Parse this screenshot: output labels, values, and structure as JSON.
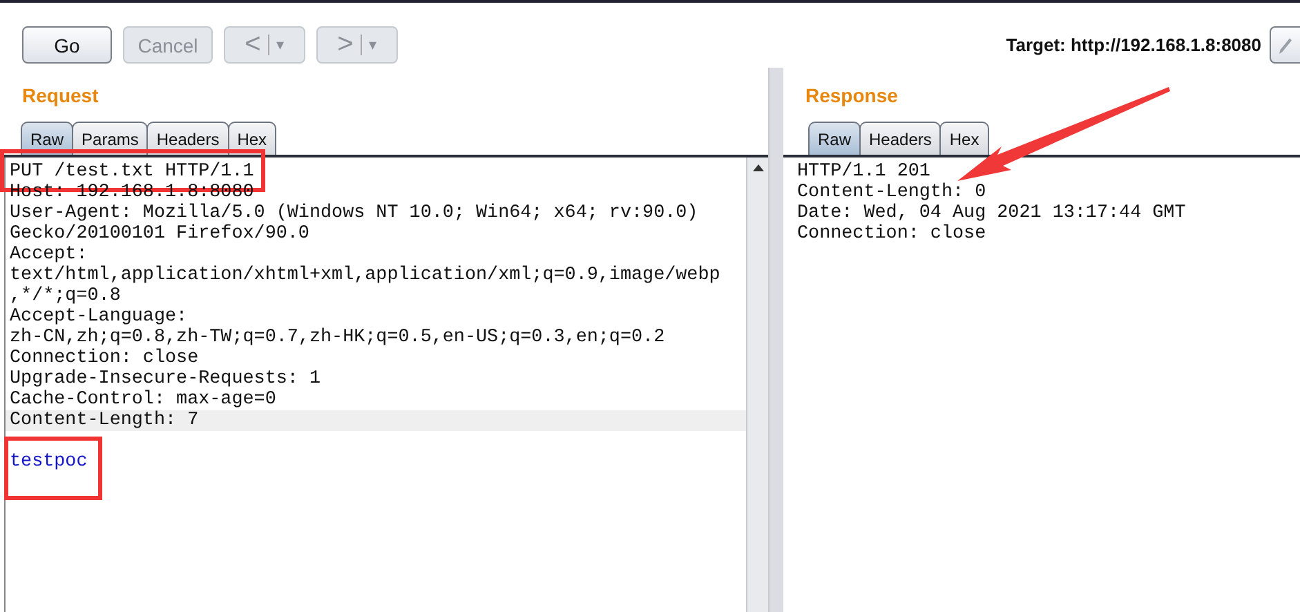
{
  "toolbar": {
    "buttons": [
      {
        "kind": "text",
        "label": "Go",
        "disabled": false
      },
      {
        "kind": "text",
        "label": "Cancel",
        "disabled": true
      },
      {
        "kind": "back",
        "label": "<",
        "caret": "▾",
        "disabled": true
      },
      {
        "kind": "forward",
        "label": ">",
        "caret": "▾",
        "disabled": true
      }
    ],
    "target": "Target: http://192.168.1.8:8080"
  },
  "request": {
    "title": "Request",
    "tabs": [
      {
        "label": "Raw",
        "selected": true
      },
      {
        "label": "Params",
        "selected": false
      },
      {
        "label": "Headers",
        "selected": false
      },
      {
        "label": "Hex",
        "selected": false
      }
    ],
    "lines": [
      {
        "kind": "header",
        "text": "PUT /test.txt HTTP/1.1",
        "boxed": true,
        "highlighted": false
      },
      {
        "kind": "header",
        "text": "Host: 192.168.1.8:8080",
        "boxed": false,
        "highlighted": false
      },
      {
        "kind": "header",
        "text": "User-Agent: Mozilla/5.0 (Windows NT 10.0; Win64; x64; rv:90.0)",
        "boxed": false,
        "highlighted": false
      },
      {
        "kind": "header",
        "text": "Gecko/20100101 Firefox/90.0",
        "boxed": false,
        "highlighted": false
      },
      {
        "kind": "header",
        "text": "Accept:",
        "boxed": false,
        "highlighted": false
      },
      {
        "kind": "header",
        "text": "text/html,application/xhtml+xml,application/xml;q=0.9,image/webp",
        "boxed": false,
        "highlighted": false
      },
      {
        "kind": "header",
        "text": ",*/*;q=0.8",
        "boxed": false,
        "highlighted": false
      },
      {
        "kind": "header",
        "text": "Accept-Language:",
        "boxed": false,
        "highlighted": false
      },
      {
        "kind": "header",
        "text": "zh-CN,zh;q=0.8,zh-TW;q=0.7,zh-HK;q=0.5,en-US;q=0.3,en;q=0.2",
        "boxed": false,
        "highlighted": false
      },
      {
        "kind": "header",
        "text": "Connection: close",
        "boxed": false,
        "highlighted": false
      },
      {
        "kind": "header",
        "text": "Upgrade-Insecure-Requests: 1",
        "boxed": false,
        "highlighted": false
      },
      {
        "kind": "header",
        "text": "Cache-Control: max-age=0",
        "boxed": false,
        "highlighted": false
      },
      {
        "kind": "header",
        "text": "Content-Length: 7",
        "boxed": false,
        "highlighted": true
      },
      {
        "kind": "blank"
      },
      {
        "kind": "body",
        "text": "testpoc",
        "boxed": true,
        "highlighted": false
      }
    ]
  },
  "response": {
    "title": "Response",
    "tabs": [
      {
        "label": "Raw",
        "selected": true
      },
      {
        "label": "Headers",
        "selected": false
      },
      {
        "label": "Hex",
        "selected": false
      }
    ],
    "lines": [
      {
        "kind": "header",
        "text": "HTTP/1.1 201",
        "boxed": false,
        "highlighted": false
      },
      {
        "kind": "header",
        "text": "Content-Length: 0",
        "boxed": false,
        "highlighted": false
      },
      {
        "kind": "header",
        "text": "Date: Wed, 04 Aug 2021 13:17:44 GMT",
        "boxed": false,
        "highlighted": false
      },
      {
        "kind": "header",
        "text": "Connection: close",
        "boxed": false,
        "highlighted": false
      }
    ]
  },
  "annotations": [
    {
      "kind": "arrow"
    }
  ]
}
